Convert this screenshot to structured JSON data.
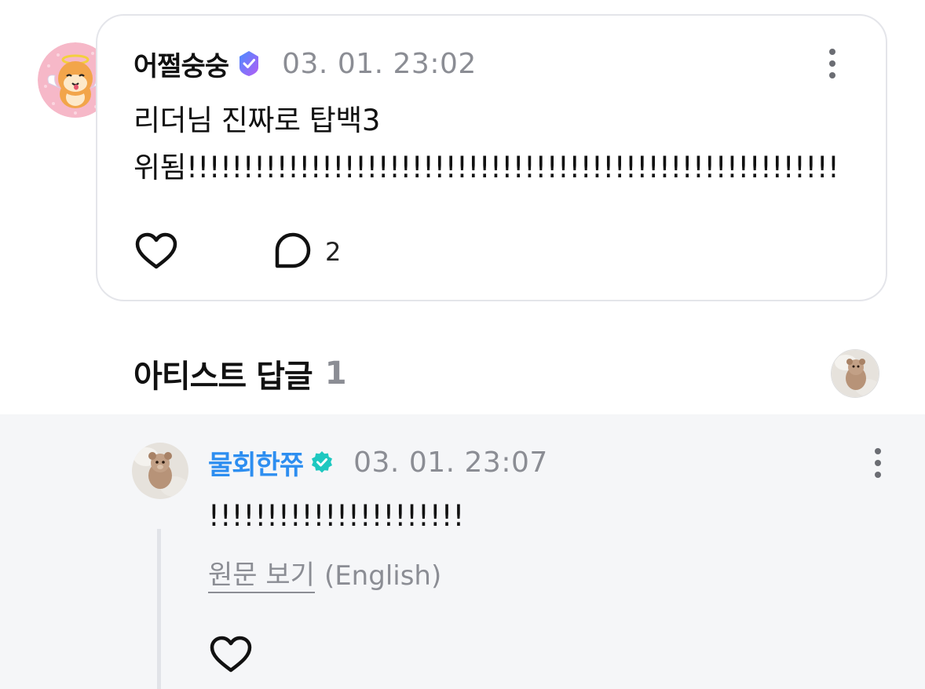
{
  "post": {
    "author": "어쩔숭숭",
    "timestamp": "03. 01. 23:02",
    "text_line1": "리더님 진짜로 탑백3",
    "text_line2": "위됨!!!!!!!!!!!!!!!!!!!!!!!!!!!!!!!!!!!!!!!!!!!!!!!!!!!!!!!!!!",
    "reply_count": "2",
    "badge_color": "#7b61ff"
  },
  "artist_replies": {
    "title": "아티스트 답글",
    "count": "1"
  },
  "reply": {
    "author": "물회한쮸",
    "timestamp": "03. 01. 23:07",
    "text": "!!!!!!!!!!!!!!!!!!!!!!",
    "translate_link": "원문 보기",
    "translate_lang": "(English)",
    "name_color": "#2d8ef0",
    "badge_color": "#1ec8c0"
  },
  "icons": [
    "heart-icon",
    "comment-bubble-icon",
    "more-vertical-icon",
    "verified-badge-icon"
  ]
}
